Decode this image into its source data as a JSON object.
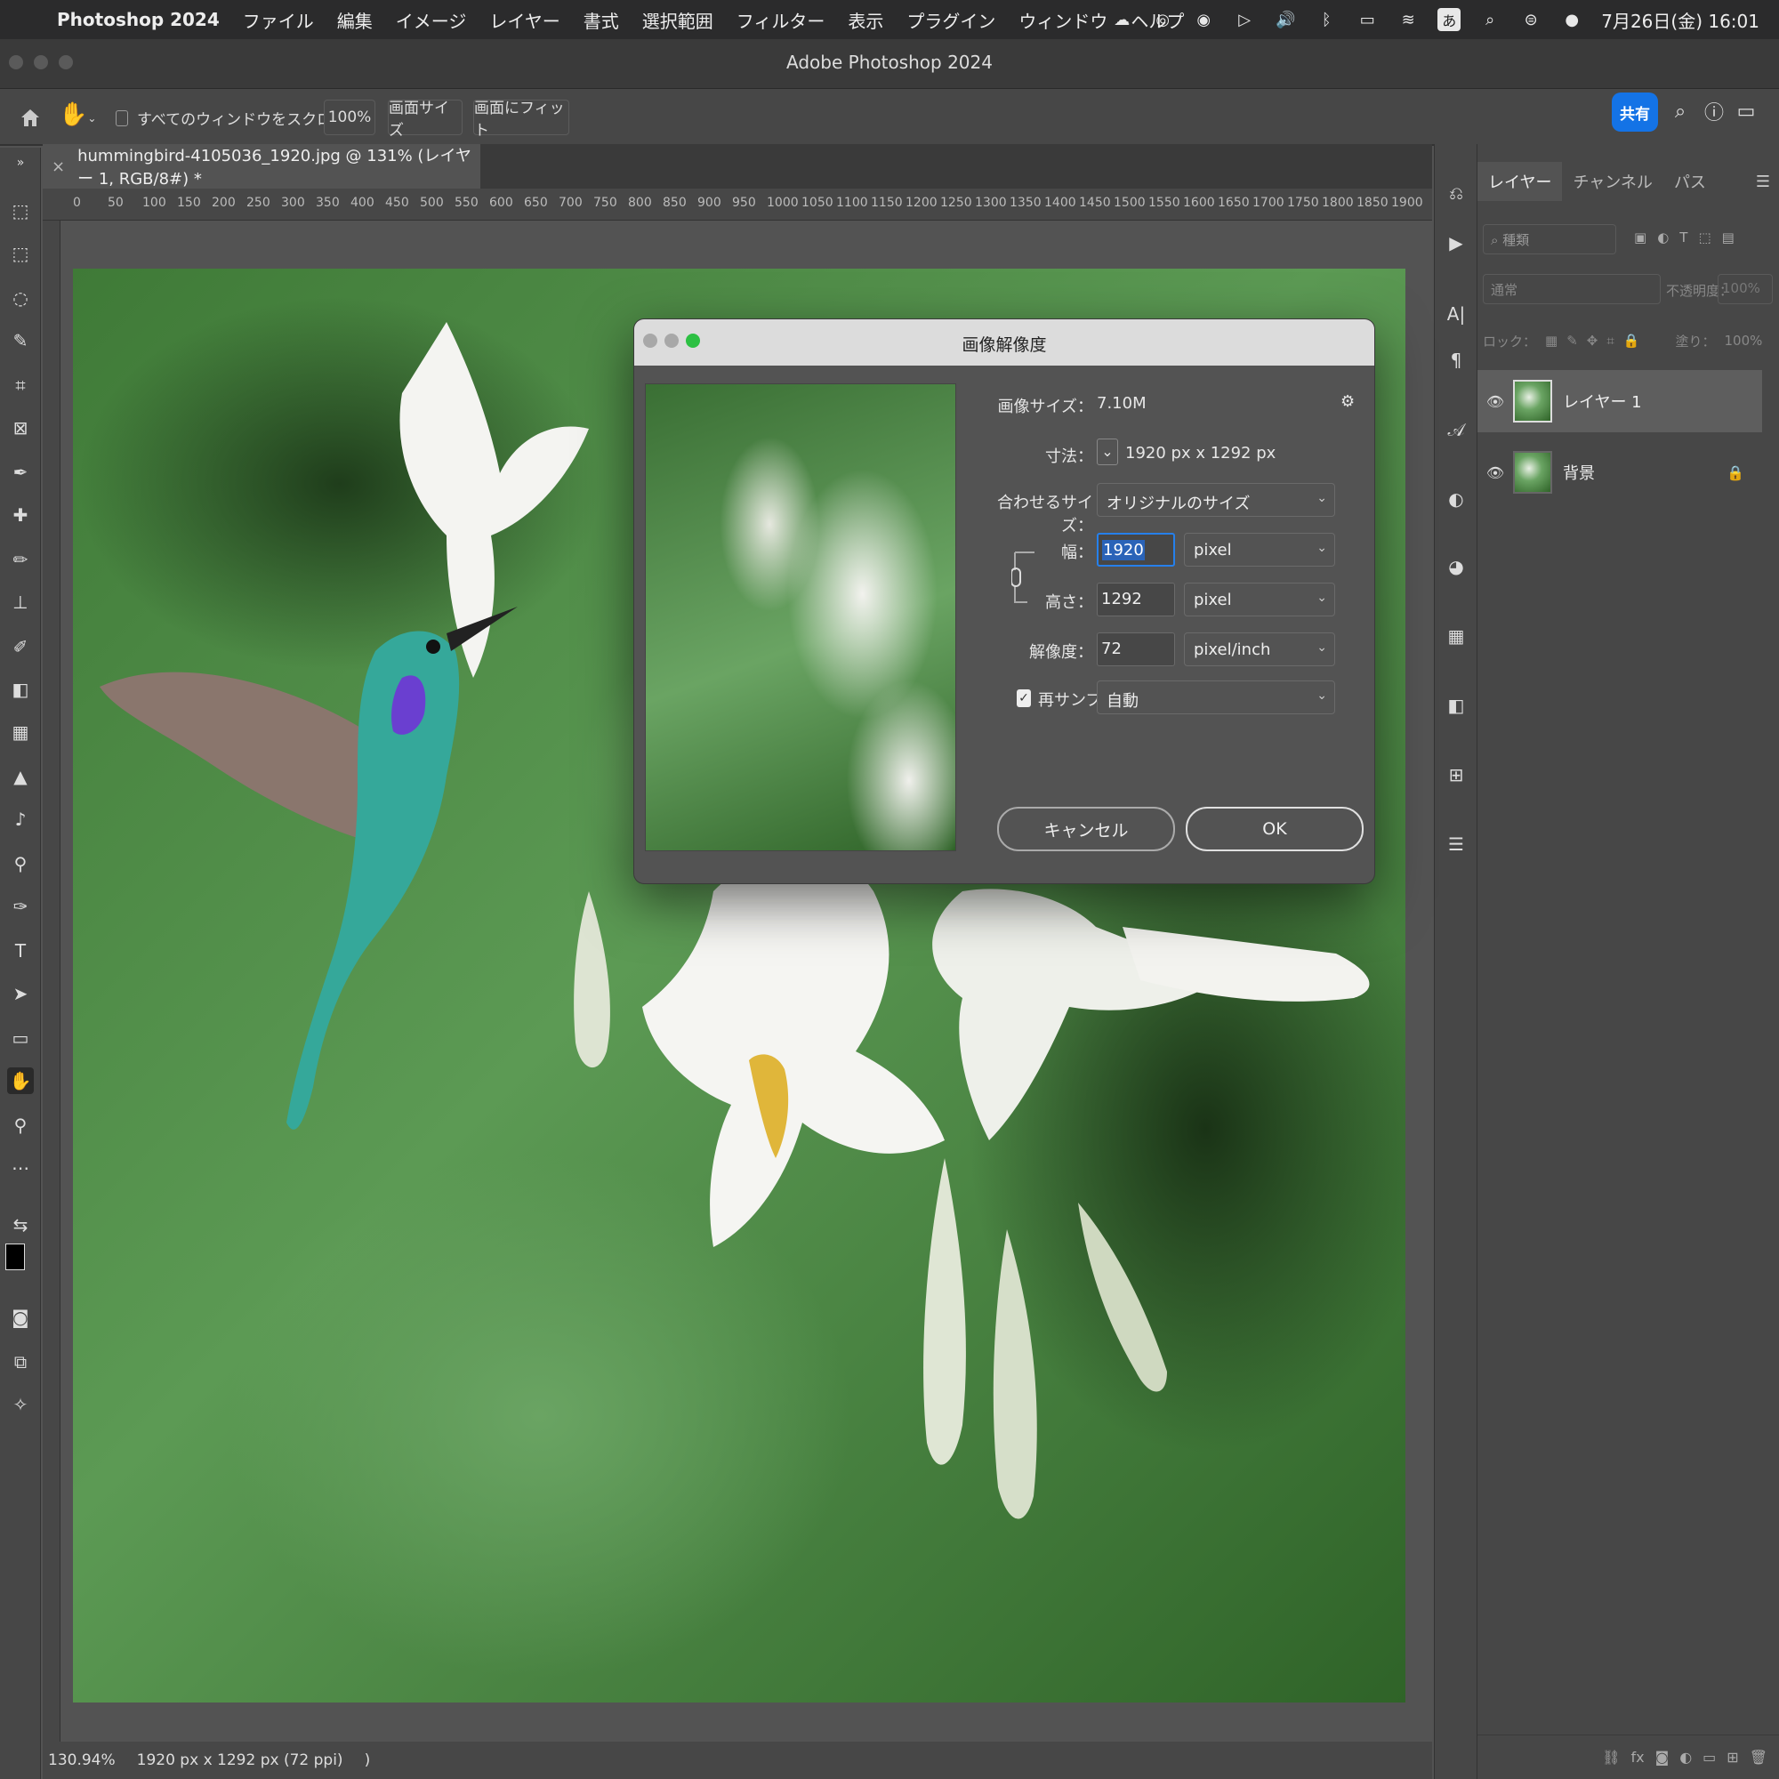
{
  "menubar": {
    "app_name": "Photoshop 2024",
    "items": [
      "ファイル",
      "編集",
      "イメージ",
      "レイヤー",
      "書式",
      "選択範囲",
      "フィルター",
      "表示",
      "プラグイン",
      "ウィンドウ",
      "ヘルプ"
    ],
    "ime": "あ",
    "clock": "7月26日(金) 16:01"
  },
  "window": {
    "title": "Adobe Photoshop 2024"
  },
  "options_bar": {
    "scroll_all_label": "すべてのウィンドウをスクロール",
    "zoom_100": "100%",
    "screen_size": "画面サイズ",
    "fit_screen": "画面にフィット",
    "share": "共有"
  },
  "document": {
    "tab_close": "×",
    "tab_title": "hummingbird-4105036_1920.jpg @ 131% (レイヤー 1, RGB/8#) *"
  },
  "ruler": {
    "top_labels": [
      "0",
      "50",
      "100",
      "150",
      "200",
      "250",
      "300",
      "350",
      "400",
      "450",
      "500",
      "550",
      "600",
      "650",
      "700",
      "750",
      "800",
      "850",
      "900",
      "950",
      "1000",
      "1050",
      "1100",
      "1150",
      "1200",
      "1250",
      "1300",
      "1350",
      "1400",
      "1450",
      "1500",
      "1550",
      "1600",
      "1650",
      "1700",
      "1750",
      "1800",
      "1850",
      "1900"
    ]
  },
  "status": {
    "zoom": "130.94%",
    "doc_info": "1920 px x 1292 px (72 ppi)",
    "arrow": ")"
  },
  "layers_panel": {
    "tabs": [
      "レイヤー",
      "チャンネル",
      "パス"
    ],
    "search_placeholder": "種類",
    "blend_mode": "通常",
    "opacity_label": "不透明度：",
    "opacity_value": "100%",
    "lock_label": "ロック：",
    "fill_label": "塗り：",
    "fill_value": "100%",
    "layers": [
      {
        "name": "レイヤー 1",
        "selected": true
      },
      {
        "name": "背景",
        "selected": false,
        "locked": true
      }
    ]
  },
  "dialog": {
    "title": "画像解像度",
    "image_size_label": "画像サイズ：",
    "image_size_value": "7.10M",
    "dimensions_label": "寸法：",
    "dimensions_value": "1920 px x 1292 px",
    "fit_label": "合わせるサイズ：",
    "fit_value": "オリジナルのサイズ",
    "width_label": "幅：",
    "width_value": "1920",
    "width_unit": "pixel",
    "height_label": "高さ：",
    "height_value": "1292",
    "height_unit": "pixel",
    "resolution_label": "解像度：",
    "resolution_value": "72",
    "resolution_unit": "pixel/inch",
    "resample_label": "再サンプル：",
    "resample_value": "自動",
    "resample_checked": true,
    "cancel": "キャンセル",
    "ok": "OK"
  },
  "colors": {
    "accent": "#1473e6",
    "focus": "#2680eb",
    "zoom_green": "#2dc043"
  }
}
